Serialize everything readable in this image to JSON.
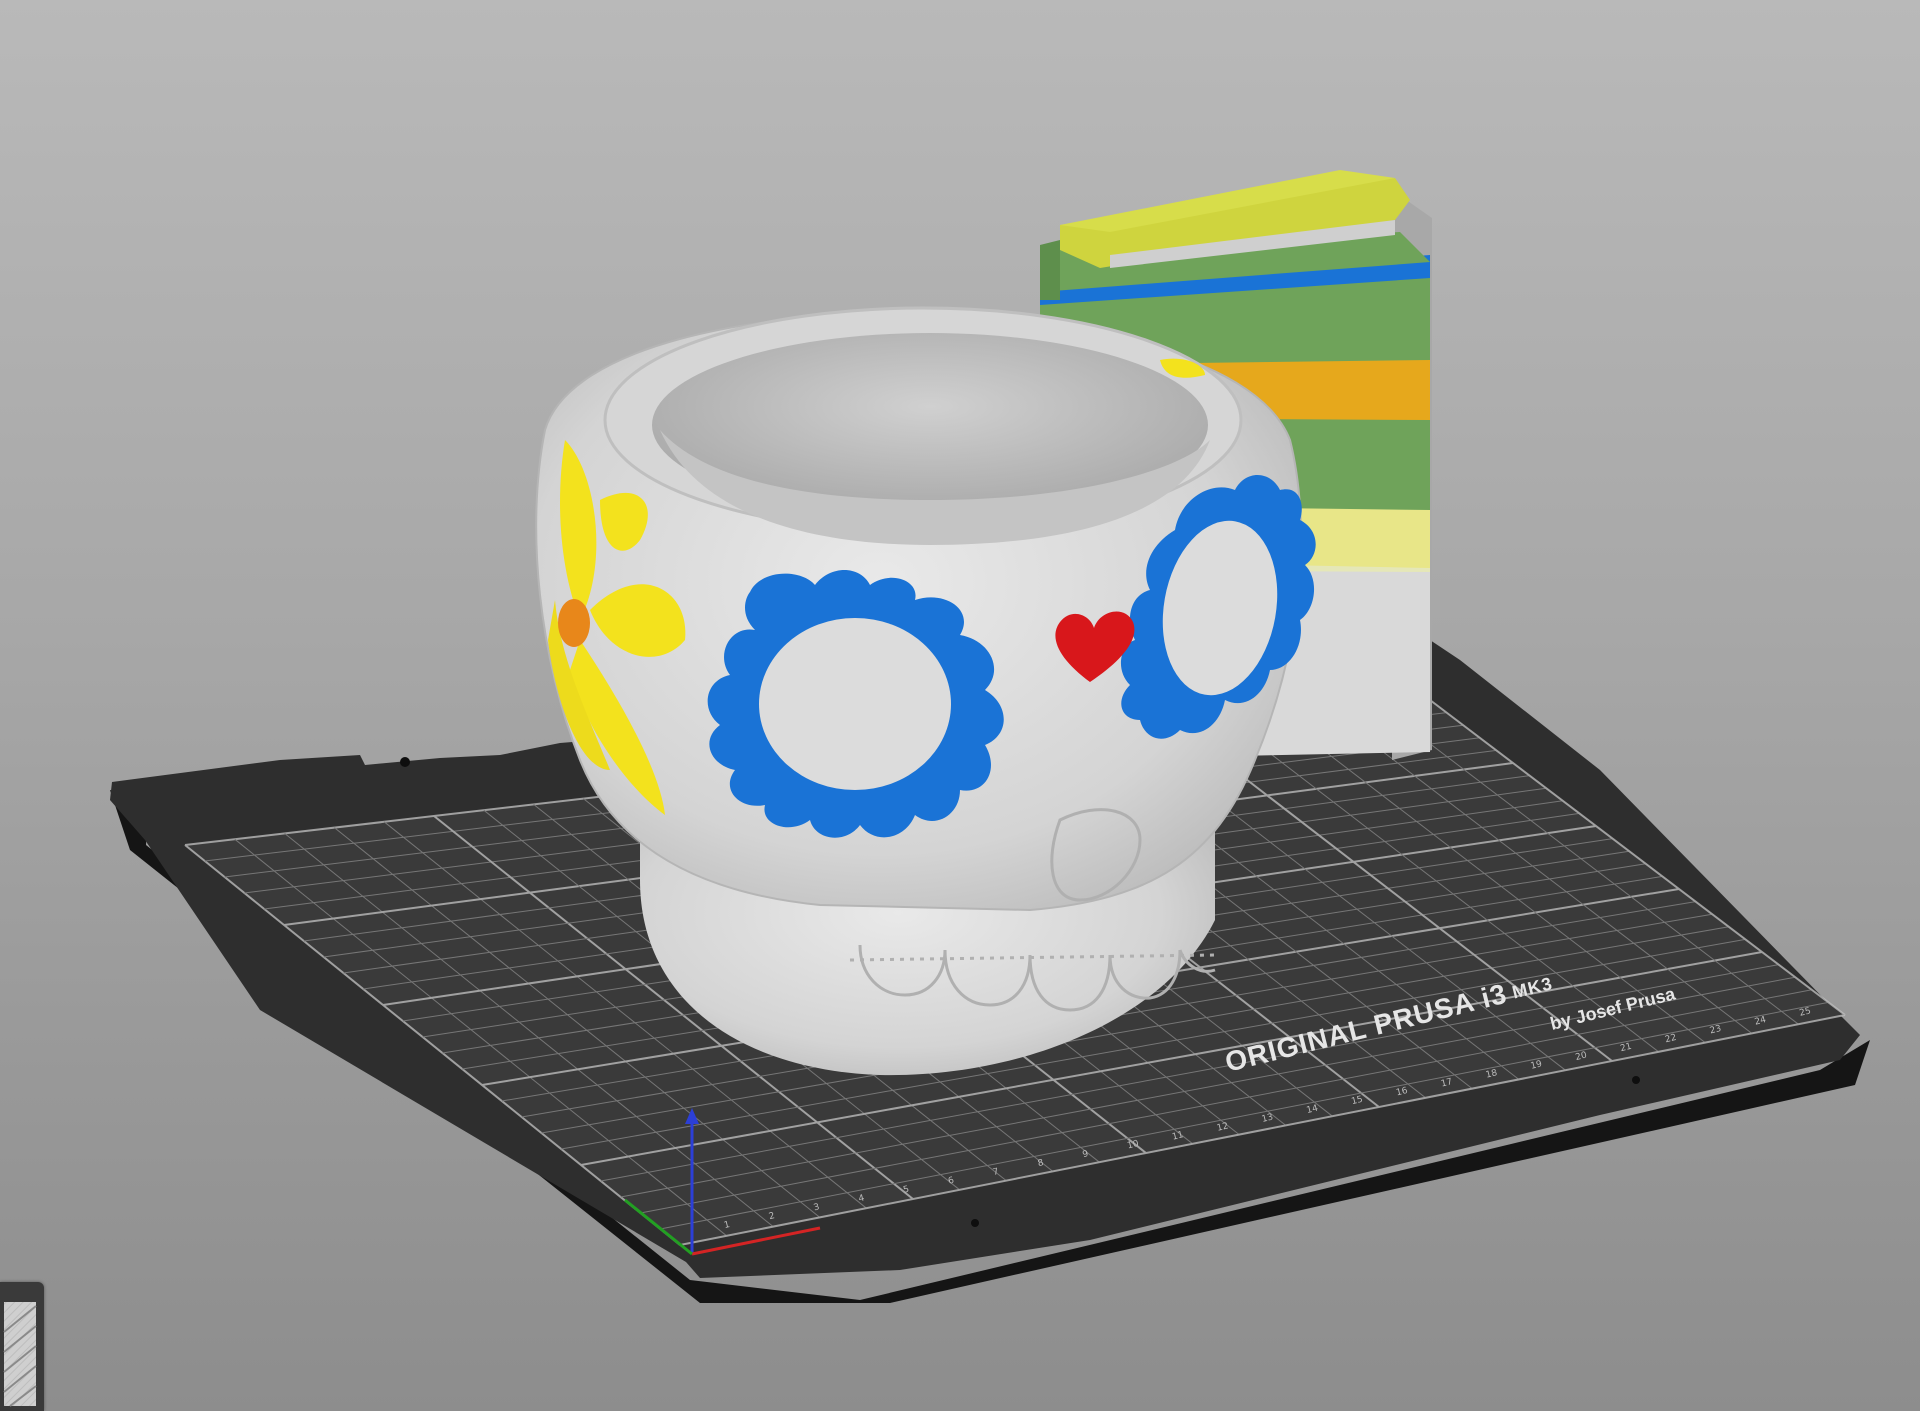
{
  "bed": {
    "brand_line1": "ORIGINAL PRUSA i3",
    "brand_model": "MK3",
    "brand_line2": "by Josef Prusa",
    "ruler_numbers": [
      "1",
      "2",
      "3",
      "4",
      "5",
      "6",
      "7",
      "8",
      "9",
      "10",
      "11",
      "12",
      "13",
      "14",
      "15",
      "16",
      "17",
      "18",
      "19",
      "20",
      "21",
      "22",
      "23",
      "24",
      "25"
    ],
    "colors": {
      "sheet": "#2f2f2f",
      "edge": "#1b1b1b",
      "grid": "#9a9a9a"
    }
  },
  "model": {
    "name": "sugar skull planter",
    "colors": {
      "body": "#dcdcdc",
      "eye_flowers": "#1a73d6",
      "side_flower": "#f3e21d",
      "flower_center": "#e8871a",
      "heart": "#d8171b"
    }
  },
  "wipe_tower": {
    "colors": [
      "#d7dd4a",
      "#1a73d6",
      "#6fa35a",
      "#e6a81c",
      "#e8e688",
      "#dcdcdc"
    ]
  },
  "axes": {
    "x_color": "#d42424",
    "y_color": "#22a022",
    "z_color": "#2c3fd6"
  },
  "corner_tool": {
    "icon": "layer-view-icon"
  }
}
